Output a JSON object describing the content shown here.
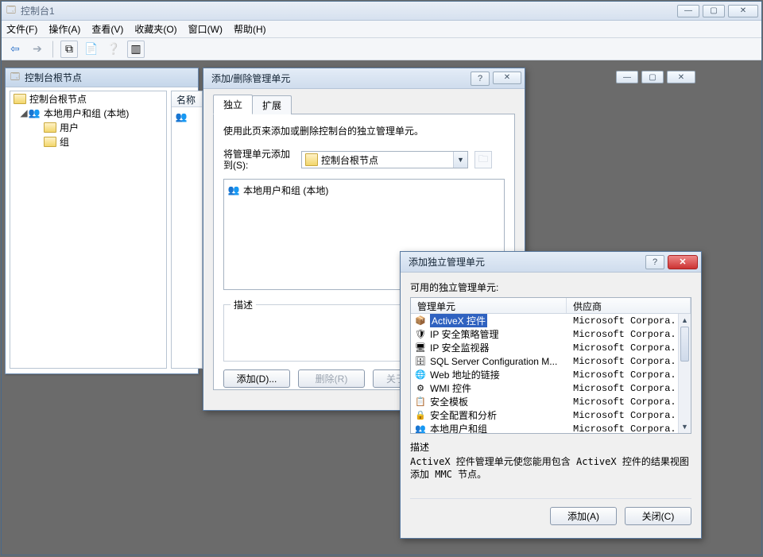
{
  "main": {
    "title": "控制台1",
    "menus": [
      "文件(F)",
      "操作(A)",
      "查看(V)",
      "收藏夹(O)",
      "窗口(W)",
      "帮助(H)"
    ]
  },
  "child1": {
    "title": "控制台根节点",
    "name_col": "名称",
    "tree": {
      "root": "控制台根节点",
      "node1": "本地用户和组 (本地)",
      "leaf1": "用户",
      "leaf2": "组"
    }
  },
  "dlg1": {
    "title": "添加/删除管理单元",
    "tab1": "独立",
    "tab2": "扩展",
    "intro": "使用此页来添加或删除控制台的独立管理单元。",
    "addto_label": "将管理单元添加到(S):",
    "addto_value": "控制台根节点",
    "list_item1": "本地用户和组 (本地)",
    "desc_label": "描述",
    "btn_add": "添加(D)...",
    "btn_remove": "删除(R)",
    "btn_about": "关于(B)..."
  },
  "dlg2": {
    "title": "添加独立管理单元",
    "avail_label": "可用的独立管理单元:",
    "col1": "管理单元",
    "col2": "供应商",
    "rows": [
      {
        "name": "ActiveX 控件",
        "vendor": "Microsoft Corpora...",
        "sel": true,
        "icon": "📦"
      },
      {
        "name": "IP 安全策略管理",
        "vendor": "Microsoft Corpora...",
        "icon": "🛡"
      },
      {
        "name": "IP 安全监视器",
        "vendor": "Microsoft Corpora...",
        "icon": "🖥"
      },
      {
        "name": "SQL Server Configuration M...",
        "vendor": "Microsoft Corpora...",
        "icon": "🗄"
      },
      {
        "name": "Web 地址的链接",
        "vendor": "Microsoft Corpora...",
        "icon": "🌐"
      },
      {
        "name": "WMI 控件",
        "vendor": "Microsoft Corpora...",
        "icon": "⚙"
      },
      {
        "name": "安全模板",
        "vendor": "Microsoft Corpora...",
        "icon": "📋"
      },
      {
        "name": "安全配置和分析",
        "vendor": "Microsoft Corpora...",
        "icon": "🔒"
      },
      {
        "name": "本地用户和组",
        "vendor": "Microsoft Corpora...",
        "icon": "👥"
      }
    ],
    "desc_label": "描述",
    "desc_text": "ActiveX 控件管理单元使您能用包含 ActiveX 控件的结果视图添加 MMC 节点。",
    "btn_add": "添加(A)",
    "btn_close": "关闭(C)"
  }
}
